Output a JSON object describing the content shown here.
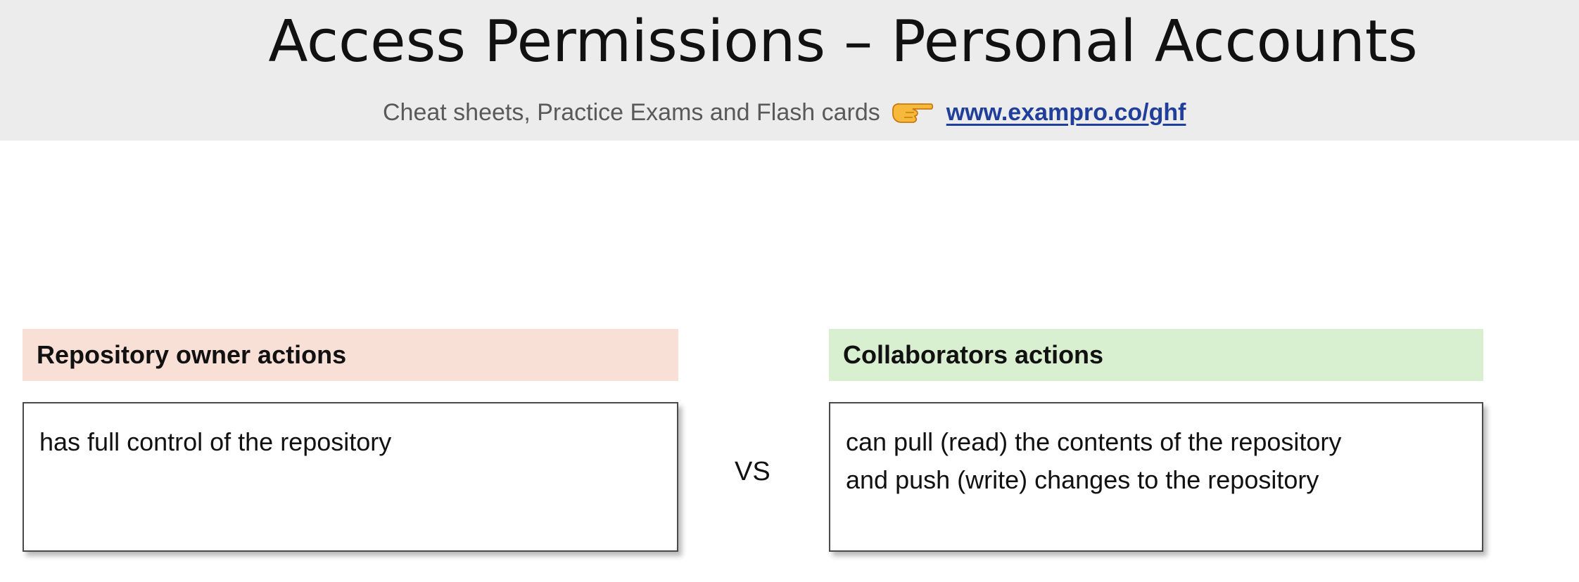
{
  "header": {
    "title": "Access Permissions – Personal Accounts",
    "subtitle_text": "Cheat sheets, Practice Exams and Flash cards",
    "pointer_icon": "backhand-index-pointing-right-icon",
    "link_text": "www.exampro.co/ghf"
  },
  "owner": {
    "heading": "Repository owner actions",
    "lines": [
      "has full control of the repository"
    ]
  },
  "comparison": {
    "vs_text": "VS"
  },
  "collaborator": {
    "heading": "Collaborators actions",
    "lines": [
      "can pull (read) the contents of the repository",
      "and push (write) changes to the repository"
    ]
  },
  "colors": {
    "header_band": "#ececec",
    "owner_heading_bg": "#f9e0d6",
    "collab_heading_bg": "#d8efd0",
    "link": "#1f3f9a"
  }
}
